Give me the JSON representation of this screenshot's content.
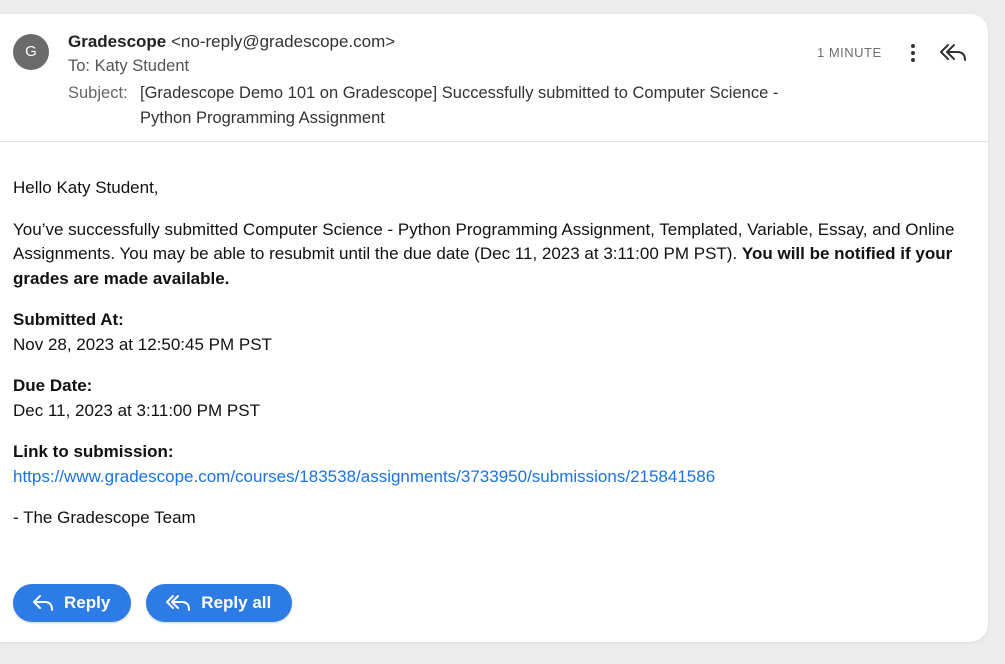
{
  "email": {
    "avatar_letter": "G",
    "sender_name": "Gradescope",
    "sender_email": "<no-reply@gradescope.com>",
    "to": "To: Katy Student",
    "subject_label": "Subject:",
    "subject": "[Gradescope Demo 101 on Gradescope] Successfully submitted to Computer Science - Python Programming Assignment",
    "time": "1 MINUTE"
  },
  "body": {
    "greeting": "Hello Katy Student,",
    "intro": "You’ve successfully submitted Computer Science - Python Programming Assignment, Templated, Variable, Essay, and Online Assignments. You may be able to resubmit until the due date (Dec 11, 2023 at 3:11:00 PM PST).",
    "intro_bold": "You will be notified if your grades are made available.",
    "submitted_label": "Submitted At:",
    "submitted_value": "Nov 28, 2023 at 12:50:45 PM PST",
    "due_label": "Due Date:",
    "due_value": "Dec 11, 2023 at 3:11:00 PM PST",
    "link_label": "Link to submission:",
    "link_url": "https://www.gradescope.com/courses/183538/assignments/3733950/submissions/215841586",
    "signoff": "- The Gradescope Team"
  },
  "actions": {
    "reply_label": "Reply",
    "reply_all_label": "Reply all"
  },
  "colors": {
    "accent": "#2d7be5",
    "link": "#1a73e8",
    "avatar": "#6b6b6b"
  },
  "icons": {
    "more": "more-vert-icon",
    "reply": "reply-icon",
    "reply_all": "reply-all-icon"
  }
}
